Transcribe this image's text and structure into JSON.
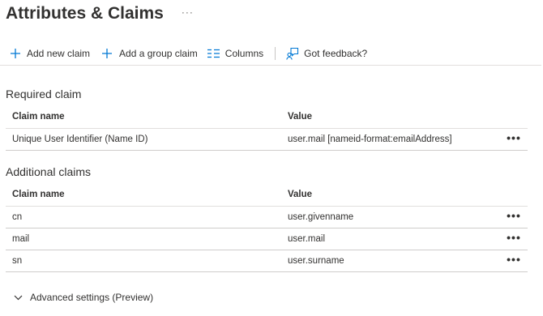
{
  "header": {
    "title": "Attributes & Claims",
    "more_label": "···"
  },
  "toolbar": {
    "add_new_claim": "Add new claim",
    "add_group_claim": "Add a group claim",
    "columns": "Columns",
    "feedback": "Got feedback?"
  },
  "required": {
    "section_title": "Required claim",
    "columns": {
      "name": "Claim name",
      "value": "Value"
    },
    "rows": [
      {
        "name": "Unique User Identifier (Name ID)",
        "value": "user.mail [nameid-format:emailAddress]",
        "more": "•••"
      }
    ]
  },
  "additional": {
    "section_title": "Additional claims",
    "columns": {
      "name": "Claim name",
      "value": "Value"
    },
    "rows": [
      {
        "name": "cn",
        "value": "user.givenname",
        "more": "•••"
      },
      {
        "name": "mail",
        "value": "user.mail",
        "more": "•••"
      },
      {
        "name": "sn",
        "value": "user.surname",
        "more": "•••"
      }
    ]
  },
  "advanced": {
    "label": "Advanced settings (Preview)"
  },
  "colors": {
    "accent": "#0078d4",
    "text": "#323130",
    "divider": "#e1dfdd"
  },
  "icons": [
    "add-icon",
    "columns-icon",
    "feedback-icon",
    "more-icon",
    "chevron-down-icon"
  ]
}
